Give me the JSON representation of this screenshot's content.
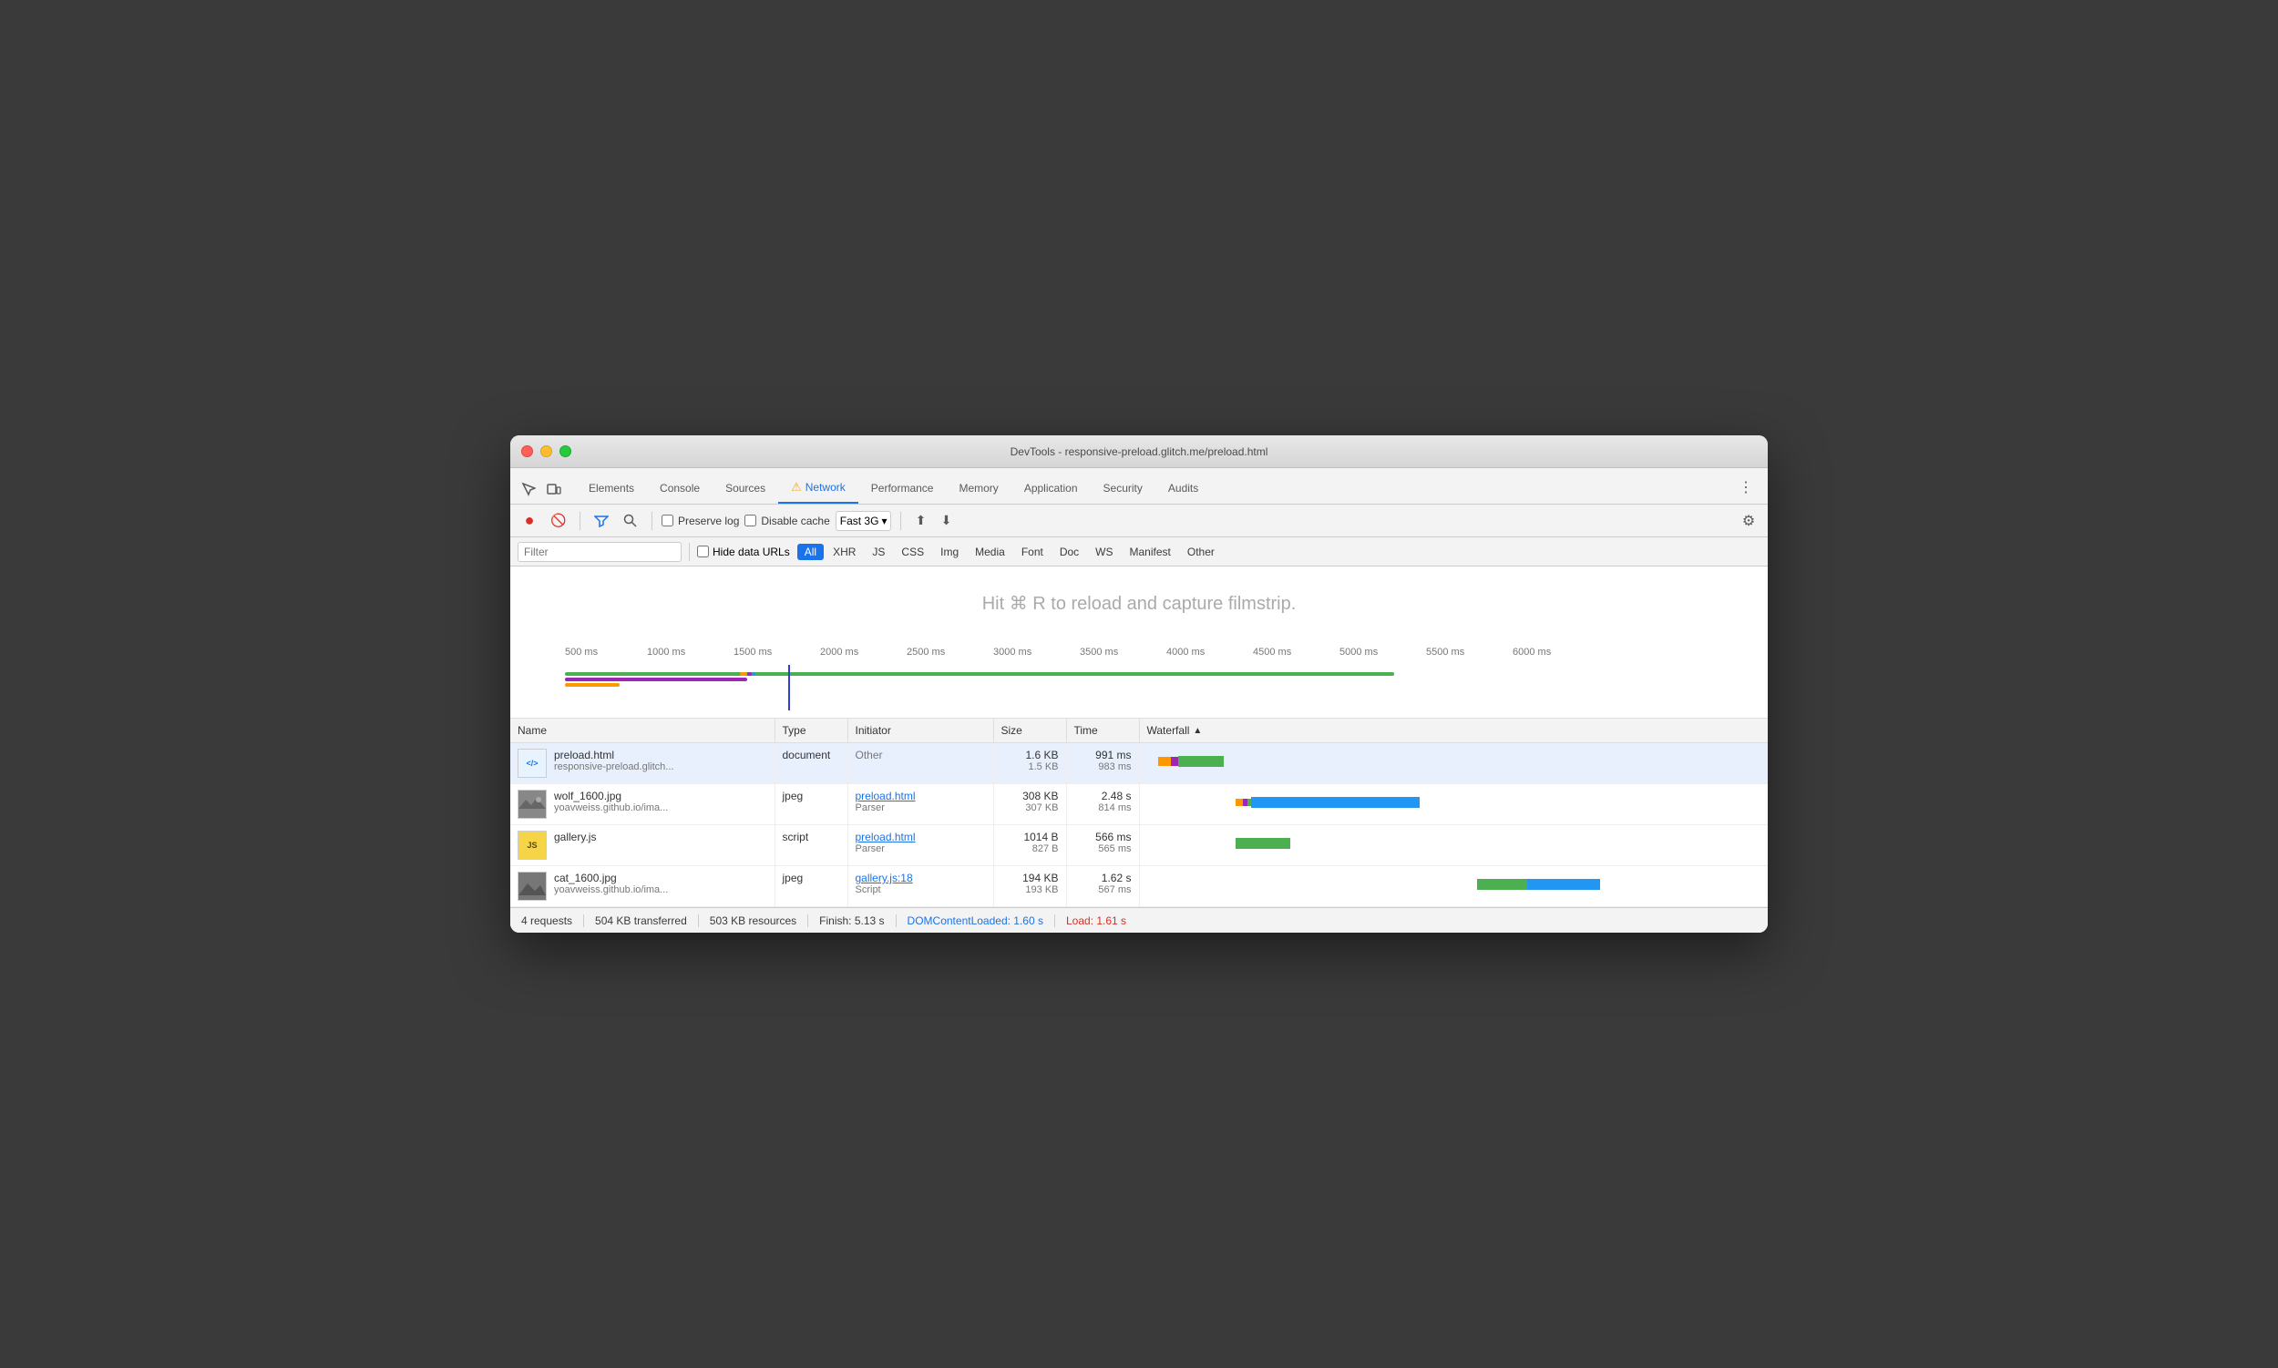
{
  "window": {
    "title": "DevTools - responsive-preload.glitch.me/preload.html"
  },
  "tabs": [
    {
      "label": "Elements",
      "active": false
    },
    {
      "label": "Console",
      "active": false
    },
    {
      "label": "Sources",
      "active": false
    },
    {
      "label": "Network",
      "active": true,
      "warn": true
    },
    {
      "label": "Performance",
      "active": false
    },
    {
      "label": "Memory",
      "active": false
    },
    {
      "label": "Application",
      "active": false
    },
    {
      "label": "Security",
      "active": false
    },
    {
      "label": "Audits",
      "active": false
    }
  ],
  "toolbar": {
    "preserve_log_label": "Preserve log",
    "disable_cache_label": "Disable cache",
    "throttle_value": "Fast 3G"
  },
  "filter": {
    "placeholder": "Filter",
    "hide_data_urls_label": "Hide data URLs",
    "types": [
      "All",
      "XHR",
      "JS",
      "CSS",
      "Img",
      "Media",
      "Font",
      "Doc",
      "WS",
      "Manifest",
      "Other"
    ],
    "active_type": "All"
  },
  "filmstrip_hint": "Hit ⌘ R to reload and capture filmstrip.",
  "timeline": {
    "ticks": [
      "500 ms",
      "1000 ms",
      "1500 ms",
      "2000 ms",
      "2500 ms",
      "3000 ms",
      "3500 ms",
      "4000 ms",
      "4500 ms",
      "5000 ms",
      "5500 ms",
      "6000 ms"
    ]
  },
  "table": {
    "columns": [
      "Name",
      "Type",
      "Initiator",
      "Size",
      "Time",
      "Waterfall"
    ],
    "rows": [
      {
        "name": "preload.html",
        "url": "responsive-preload.glitch...",
        "type": "document",
        "initiator": "Other",
        "initiator_link": null,
        "size_top": "1.6 KB",
        "size_bottom": "1.5 KB",
        "time_top": "991 ms",
        "time_bottom": "983 ms",
        "selected": true,
        "icon_type": "doc"
      },
      {
        "name": "wolf_1600.jpg",
        "url": "yoavweiss.github.io/ima...",
        "type": "jpeg",
        "initiator": "preload.html",
        "initiator_sub": "Parser",
        "initiator_link": true,
        "size_top": "308 KB",
        "size_bottom": "307 KB",
        "time_top": "2.48 s",
        "time_bottom": "814 ms",
        "selected": false,
        "icon_type": "img"
      },
      {
        "name": "gallery.js",
        "url": "",
        "type": "script",
        "initiator": "preload.html",
        "initiator_sub": "Parser",
        "initiator_link": true,
        "size_top": "1014 B",
        "size_bottom": "827 B",
        "time_top": "566 ms",
        "time_bottom": "565 ms",
        "selected": false,
        "icon_type": "js"
      },
      {
        "name": "cat_1600.jpg",
        "url": "yoavweiss.github.io/ima...",
        "type": "jpeg",
        "initiator": "gallery.js:18",
        "initiator_sub": "Script",
        "initiator_link": true,
        "size_top": "194 KB",
        "size_bottom": "193 KB",
        "time_top": "1.62 s",
        "time_bottom": "567 ms",
        "selected": false,
        "icon_type": "img"
      }
    ]
  },
  "status": {
    "requests": "4 requests",
    "transferred": "504 KB transferred",
    "resources": "503 KB resources",
    "finish": "Finish: 5.13 s",
    "dom_loaded": "DOMContentLoaded: 1.60 s",
    "load": "Load: 1.61 s"
  }
}
